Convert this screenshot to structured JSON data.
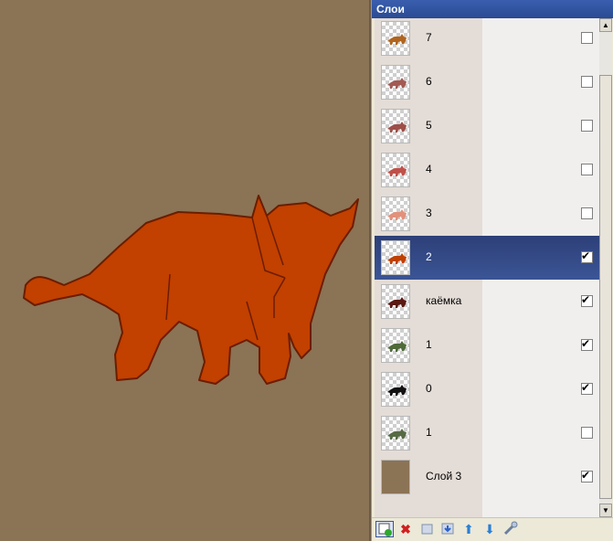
{
  "panel": {
    "title": "Слои"
  },
  "layers": [
    {
      "name": "7",
      "visible": false,
      "selected": false,
      "thumb_color": "#b0651f"
    },
    {
      "name": "6",
      "visible": false,
      "selected": false,
      "thumb_color": "#a35a53"
    },
    {
      "name": "5",
      "visible": false,
      "selected": false,
      "thumb_color": "#9d4f48"
    },
    {
      "name": "4",
      "visible": false,
      "selected": false,
      "thumb_color": "#c0504a"
    },
    {
      "name": "3",
      "visible": false,
      "selected": false,
      "thumb_color": "#e2917b"
    },
    {
      "name": "2",
      "visible": true,
      "selected": true,
      "thumb_color": "#c04000"
    },
    {
      "name": "каёмка",
      "visible": true,
      "selected": false,
      "thumb_color": "#5a1a12"
    },
    {
      "name": "1",
      "visible": true,
      "selected": false,
      "thumb_color": "#4f6a3a"
    },
    {
      "name": "0",
      "visible": true,
      "selected": false,
      "thumb_color": "#111111"
    },
    {
      "name": "1",
      "visible": false,
      "selected": false,
      "thumb_color": "#566b44"
    },
    {
      "name": "Слой 3",
      "visible": true,
      "selected": false,
      "thumb_color": "#8b7355",
      "solid": true
    }
  ],
  "colors": {
    "background": "#8b7355",
    "creature_fill": "#c24000",
    "creature_outline": "#6b1d00",
    "selection": "#3a5596"
  },
  "toolbar": {
    "icons": [
      "add-layer-icon",
      "delete-layer-icon",
      "duplicate-layer-icon",
      "merge-down-icon",
      "move-up-icon",
      "move-down-icon",
      "properties-icon"
    ]
  }
}
